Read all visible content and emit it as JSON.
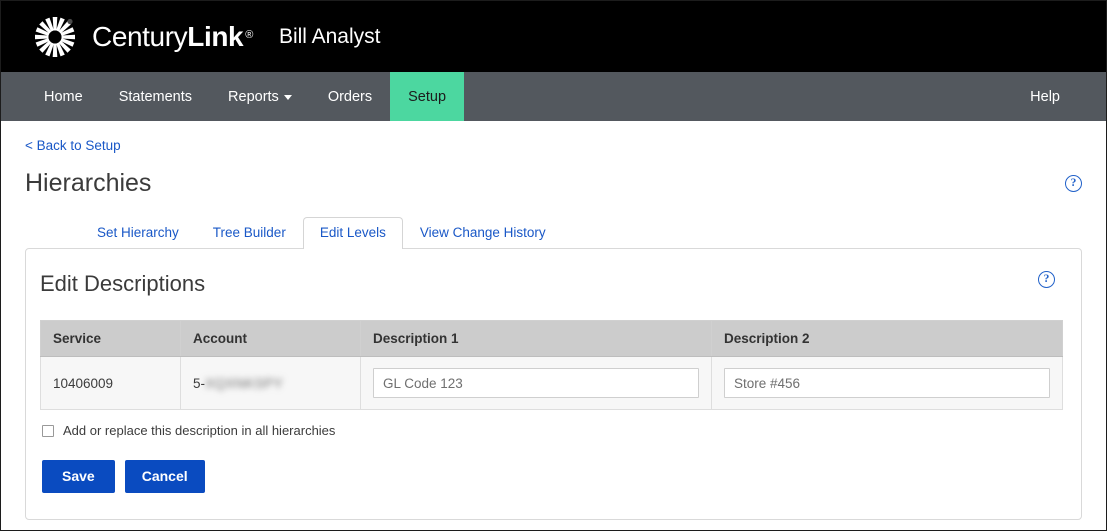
{
  "brand": {
    "logo_icon": "centurylink-starburst-icon",
    "name_light": "Century",
    "name_bold": "Link",
    "registered_mark": "®",
    "app_name": "Bill Analyst"
  },
  "nav": {
    "items": [
      {
        "label": "Home",
        "active": false,
        "has_caret": false
      },
      {
        "label": "Statements",
        "active": false,
        "has_caret": false
      },
      {
        "label": "Reports",
        "active": false,
        "has_caret": true
      },
      {
        "label": "Orders",
        "active": false,
        "has_caret": false
      },
      {
        "label": "Setup",
        "active": true,
        "has_caret": false
      }
    ],
    "help_label": "Help",
    "active_color": "#4cd7a0",
    "bar_color": "#53585e"
  },
  "page": {
    "back_link": "< Back to Setup",
    "title": "Hierarchies",
    "help_icon": "question-mark-circle-icon",
    "help_glyph": "?"
  },
  "tabs": [
    {
      "label": "Set Hierarchy",
      "active": false
    },
    {
      "label": "Tree Builder",
      "active": false
    },
    {
      "label": "Edit Levels",
      "active": true
    },
    {
      "label": "View Change History",
      "active": false
    }
  ],
  "panel": {
    "title": "Edit Descriptions",
    "help_glyph": "?",
    "table": {
      "columns": [
        "Service",
        "Account",
        "Description 1",
        "Description 2"
      ],
      "rows": [
        {
          "service": "10406009",
          "account_prefix": "5-",
          "account_redacted": "XQXNKSPY",
          "description1_value": "",
          "description1_placeholder": "GL Code 123",
          "description2_value": "",
          "description2_placeholder": "Store #456"
        }
      ]
    },
    "checkbox": {
      "label": "Add or replace this description in all hierarchies",
      "checked": false
    },
    "buttons": {
      "save": "Save",
      "cancel": "Cancel",
      "color": "#0a4bc0"
    }
  }
}
